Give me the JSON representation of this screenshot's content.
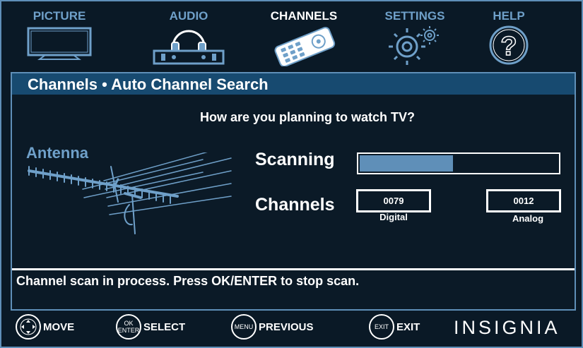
{
  "menu": {
    "tabs": [
      {
        "label": "PICTURE",
        "icon": "tv-icon"
      },
      {
        "label": "AUDIO",
        "icon": "headphones-icon"
      },
      {
        "label": "CHANNELS",
        "icon": "remote-icon"
      },
      {
        "label": "SETTINGS",
        "icon": "gears-icon"
      },
      {
        "label": "HELP",
        "icon": "help-icon"
      }
    ],
    "active": "CHANNELS"
  },
  "panel": {
    "title": "Channels • Auto Channel Search",
    "question": "How are you planning to watch TV?",
    "antenna_label": "Antenna",
    "scanning_label": "Scanning",
    "scan_progress": 0.47,
    "channels_label": "Channels",
    "digital_count": "0079",
    "digital_caption": "Digital",
    "analog_count": "0012",
    "analog_caption": "Analog",
    "status": "Channel scan in process. Press OK/ENTER to stop scan."
  },
  "footer": {
    "move_label": "MOVE",
    "ok_top": "OK",
    "ok_bottom": "ENTER",
    "select_label": "SELECT",
    "menu_ring": "MENU",
    "previous_label": "PREVIOUS",
    "exit_ring": "EXIT",
    "exit_label": "EXIT",
    "brand": "INSIGNIA"
  },
  "colors": {
    "accent": "#5f8fb8",
    "header_bar": "#174a70",
    "background": "#0a1926",
    "inactive_tab": "#6fa0c9"
  }
}
